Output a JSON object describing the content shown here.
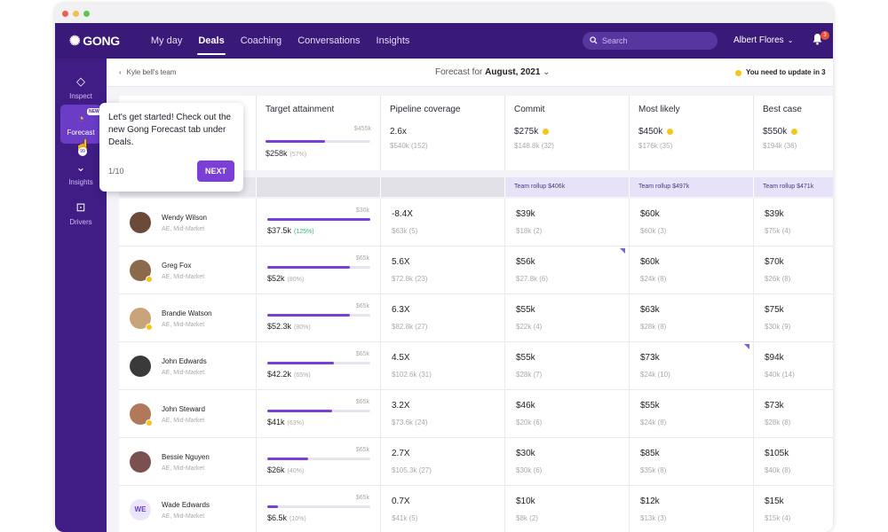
{
  "window": {
    "dots": [
      "#ee5d51",
      "#f5bd4f",
      "#5fc454"
    ]
  },
  "nav": {
    "logo": "GONG",
    "links": [
      {
        "label": "My day",
        "active": false
      },
      {
        "label": "Deals",
        "active": true
      },
      {
        "label": "Coaching",
        "active": false
      },
      {
        "label": "Conversations",
        "active": false
      },
      {
        "label": "Insights",
        "active": false
      }
    ],
    "search_placeholder": "Search",
    "user": "Albert Flores",
    "bell_count": "3"
  },
  "sidebar": {
    "items": [
      {
        "label": "Inspect",
        "icon": "diamond-icon"
      },
      {
        "label": "Forecast",
        "icon": "forecast-icon"
      },
      {
        "label": "Insights",
        "icon": "insights-icon"
      },
      {
        "label": "Drivers",
        "icon": "drivers-icon"
      }
    ],
    "new_badge": "NEW",
    "cursor_badge": "99"
  },
  "tooltip": {
    "text": "Let's get started! Check out the new Gong Forecast tab under Deals.",
    "step": "1/10",
    "button": "NEXT"
  },
  "subheader": {
    "breadcrumb": "Kyle bell's team",
    "forecast_prefix": "Forecast for",
    "forecast_month": "August, 2021",
    "update_note": "You need to update in 3"
  },
  "summary": {
    "target": {
      "label": "Target attainment",
      "range": "$455k",
      "value": "$258k",
      "pct": "(57%)",
      "fill": 0.57
    },
    "pipeline": {
      "label": "Pipeline coverage",
      "value": "2.6x",
      "sub": "$540k (152)"
    },
    "commit": {
      "label": "Commit",
      "value": "$275k",
      "sub": "$148.8k (32)"
    },
    "likely": {
      "label": "Most likely",
      "value": "$450k",
      "sub": "$176k (35)"
    },
    "best": {
      "label": "Best case",
      "value": "$550k",
      "sub": "$194k (36)"
    }
  },
  "rollups": {
    "commit": "Team rollup $406k",
    "likely": "Team rollup $497k",
    "best": "Team rollup $471k"
  },
  "status_color": "#f5c518",
  "rows": [
    {
      "name": "Wendy Wilson",
      "role": "AE, Mid-Market",
      "avatar": "#6b4a3a",
      "dot": false,
      "initials": "",
      "t_range": "$30k",
      "t_value": "$37.5k",
      "t_pct": "(125%)",
      "t_good": true,
      "t_fill": 1.0,
      "pipe": "-8.4X",
      "pipe_sub": "$63k (5)",
      "commit": "$39k",
      "commit_sub": "$18k (2)",
      "likely": "$60k",
      "likely_sub": "$60k (3)",
      "best": "$39k",
      "best_sub": "$75k (4)",
      "flag": false
    },
    {
      "name": "Greg Fox",
      "role": "AE, Mid-Market",
      "avatar": "#8a6a4a",
      "dot": true,
      "initials": "",
      "t_range": "$65k",
      "t_value": "$52k",
      "t_pct": "(80%)",
      "t_good": false,
      "t_fill": 0.8,
      "pipe": "5.6X",
      "pipe_sub": "$72.8k (23)",
      "commit": "$56k",
      "commit_sub": "$27.8k (6)",
      "likely": "$60k",
      "likely_sub": "$24k (8)",
      "best": "$70k",
      "best_sub": "$26k (8)",
      "flag": true
    },
    {
      "name": "Brandie Watson",
      "role": "AE, Mid-Market",
      "avatar": "#c9a37a",
      "dot": true,
      "initials": "",
      "t_range": "$65k",
      "t_value": "$52.3k",
      "t_pct": "(80%)",
      "t_good": false,
      "t_fill": 0.8,
      "pipe": "6.3X",
      "pipe_sub": "$82.8k (27)",
      "commit": "$55k",
      "commit_sub": "$22k (4)",
      "likely": "$63k",
      "likely_sub": "$28k (8)",
      "best": "$75k",
      "best_sub": "$30k (9)",
      "flag": false
    },
    {
      "name": "John Edwards",
      "role": "AE, Mid-Market",
      "avatar": "#3a3a3a",
      "dot": false,
      "initials": "",
      "t_range": "$65k",
      "t_value": "$42.2k",
      "t_pct": "(65%)",
      "t_good": false,
      "t_fill": 0.65,
      "pipe": "4.5X",
      "pipe_sub": "$102.6k (31)",
      "commit": "$55k",
      "commit_sub": "$28k (7)",
      "likely": "$73k",
      "likely_sub": "$24k (10)",
      "best": "$94k",
      "best_sub": "$40k (14)",
      "flag": true
    },
    {
      "name": "John Steward",
      "role": "AE, Mid-Market",
      "avatar": "#b07a5a",
      "dot": true,
      "initials": "",
      "t_range": "$65k",
      "t_value": "$41k",
      "t_pct": "(63%)",
      "t_good": false,
      "t_fill": 0.63,
      "pipe": "3.2X",
      "pipe_sub": "$73.6k (24)",
      "commit": "$46k",
      "commit_sub": "$20k (6)",
      "likely": "$55k",
      "likely_sub": "$24k (8)",
      "best": "$73k",
      "best_sub": "$28k (8)",
      "flag": false
    },
    {
      "name": "Bessie Nguyen",
      "role": "AE, Mid-Market",
      "avatar": "#7a5050",
      "dot": false,
      "initials": "",
      "t_range": "$65k",
      "t_value": "$26k",
      "t_pct": "(40%)",
      "t_good": false,
      "t_fill": 0.4,
      "pipe": "2.7X",
      "pipe_sub": "$105.3k (27)",
      "commit": "$30k",
      "commit_sub": "$30k (6)",
      "likely": "$85k",
      "likely_sub": "$35k (8)",
      "best": "$105k",
      "best_sub": "$40k (8)",
      "flag": false
    },
    {
      "name": "Wade Edwards",
      "role": "AE, Mid-Market",
      "avatar": "",
      "dot": false,
      "initials": "WE",
      "t_range": "$65k",
      "t_value": "$6.5k",
      "t_pct": "(10%)",
      "t_good": false,
      "t_fill": 0.1,
      "pipe": "0.7X",
      "pipe_sub": "$41k (5)",
      "commit": "$10k",
      "commit_sub": "$8k (2)",
      "likely": "$12k",
      "likely_sub": "$13k (3)",
      "best": "$15k",
      "best_sub": "$15k (4)",
      "flag": false
    }
  ]
}
